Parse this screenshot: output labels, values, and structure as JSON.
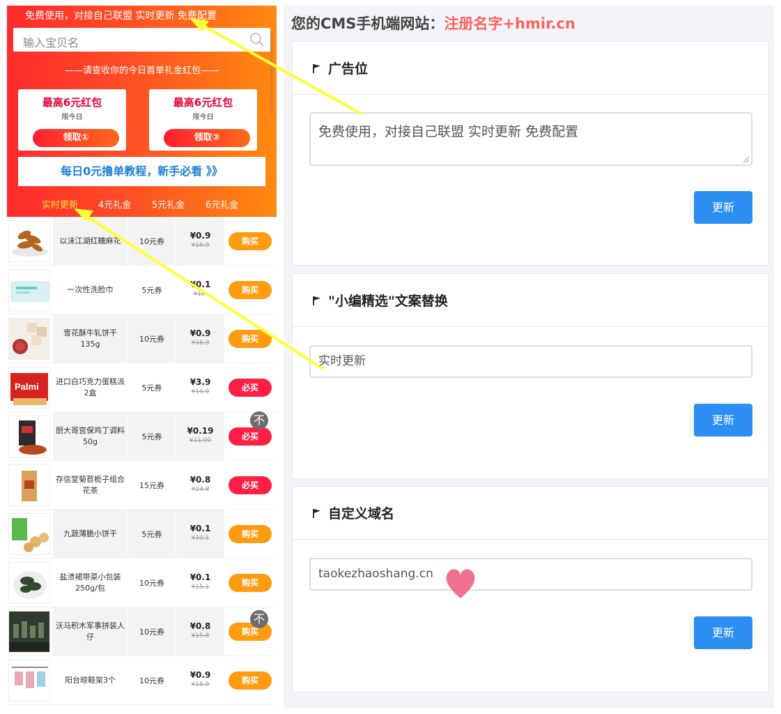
{
  "phone": {
    "marquee": "免费使用，对接自己联盟 实时更新 免费配置",
    "search_placeholder": "输入宝贝名",
    "promo_title": "——请查收你的今日首单礼金红包——",
    "coupons": [
      {
        "title": "最高6元红包",
        "sub": "限今日",
        "button": "领取①"
      },
      {
        "title": "最高6元红包",
        "sub": "限今日",
        "button": "领取②"
      }
    ],
    "tutorial": "每日0元撸单教程，新手必看 》》",
    "tabs": [
      "实时更新",
      "4元礼金",
      "5元礼金",
      "6元礼金"
    ],
    "products": [
      {
        "name": "以沫江湖红糖麻花",
        "coupon": "10元券",
        "price": "¥0.9",
        "old_price": "¥16.9",
        "button": "购买",
        "image": "twisted-dough-image"
      },
      {
        "name": "一次性洗脸巾",
        "coupon": "5元券",
        "price": "¥0.1",
        "old_price": "¥10.",
        "button": "购买",
        "image": "face-towel-image"
      },
      {
        "name": "雪花酥牛轧饼干135g",
        "coupon": "10元券",
        "price": "¥0.9",
        "old_price": "¥16.9",
        "button": "购买",
        "image": "nougat-biscuit-image"
      },
      {
        "name": "进口白巧克力蛋糕派2盒",
        "coupon": "5元券",
        "price": "¥3.9",
        "old_price": "¥14.9",
        "button": "必买",
        "image": "palmi-cake-image"
      },
      {
        "name": "厨大哥宫保鸡丁调料50g",
        "coupon": "5元券",
        "price": "¥0.19",
        "old_price": "¥11.99",
        "button": "必买",
        "image": "seasoning-image"
      },
      {
        "name": "存信堂菊苣栀子组合花茶",
        "coupon": "15元券",
        "price": "¥0.8",
        "old_price": "¥24.8",
        "button": "必买",
        "image": "flower-tea-image"
      },
      {
        "name": "九蔬薄脆小饼干",
        "coupon": "5元券",
        "price": "¥0.1",
        "old_price": "¥10.1",
        "button": "购买",
        "image": "cracker-image"
      },
      {
        "name": "盐渍裙带菜小包装250g/包",
        "coupon": "10元券",
        "price": "¥0.1",
        "old_price": "¥15.1",
        "button": "购买",
        "image": "seaweed-image"
      },
      {
        "name": "沃马积木军事拼装人仔",
        "coupon": "10元券",
        "price": "¥0.8",
        "old_price": "¥15.8",
        "button": "购买",
        "image": "building-blocks-image"
      },
      {
        "name": "阳台晾鞋架3个",
        "coupon": "10元券",
        "price": "¥0.9",
        "old_price": "¥16.9",
        "button": "购买",
        "image": "shoe-rack-image"
      }
    ],
    "to_top": "不"
  },
  "admin": {
    "title_prefix": "您的CMS手机端网站：",
    "title_highlight": "注册名字+hmir.cn",
    "sections": [
      {
        "title": "广告位",
        "value": "免费使用，对接自己联盟  实时更新 免费配置",
        "button": "更新"
      },
      {
        "title": "\"小编精选\"文案替换",
        "value": "实时更新",
        "button": "更新"
      },
      {
        "title": "自定义域名",
        "value": "taokezhaoshang.cn",
        "button": "更新"
      }
    ]
  },
  "colors": {
    "header_gradient_start": "#ff2a2d",
    "header_gradient_end": "#ff8a0f",
    "buy_button": "#ff9b10",
    "must_buy_button": "#ff1f45",
    "update_button": "#2d8ef2",
    "title_highlight": "#ff6161",
    "annotation_arrow": "#ffff33",
    "heart": "#f0718f"
  }
}
